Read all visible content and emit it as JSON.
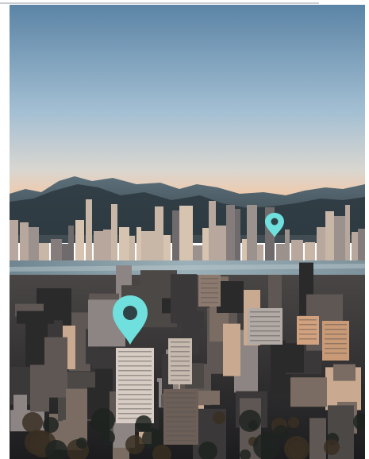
{
  "photo": {
    "subject": "aerial-city-skyline-at-dusk",
    "colors": {
      "sky_top": "#5b84a5",
      "sky_mid": "#a3bfd3",
      "sky_horizon": "#f2c8a6",
      "mountains": "#2e3a40",
      "water": "#8aa1ab",
      "city_dark": "#2a2a2c",
      "city_light": "#d9b39a",
      "pin": "#6fe0dd",
      "pin_dot": "#2f4346"
    },
    "markers": [
      {
        "icon": "map-pin-icon",
        "kind": "location-marker-large"
      },
      {
        "icon": "map-pin-icon",
        "kind": "location-marker-small"
      }
    ]
  }
}
